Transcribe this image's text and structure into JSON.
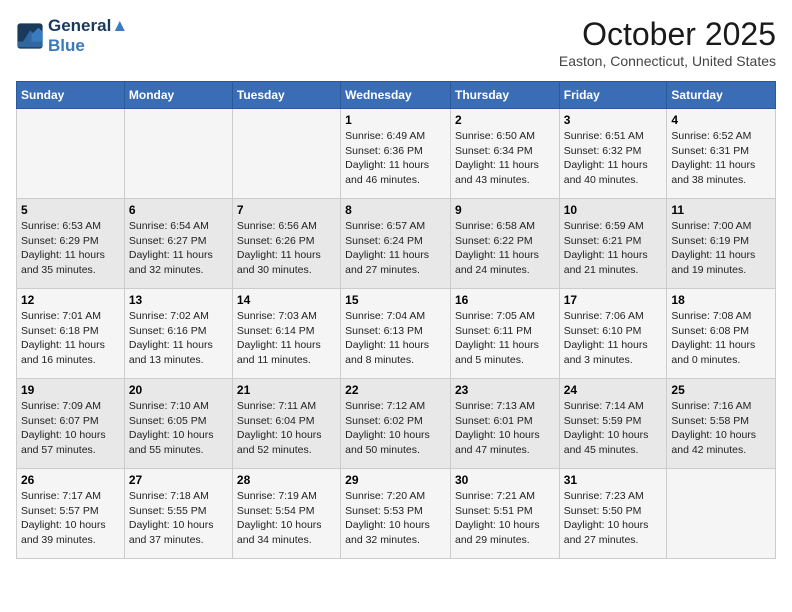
{
  "header": {
    "logo_line1": "General",
    "logo_line2": "Blue",
    "month_title": "October 2025",
    "location": "Easton, Connecticut, United States"
  },
  "days_of_week": [
    "Sunday",
    "Monday",
    "Tuesday",
    "Wednesday",
    "Thursday",
    "Friday",
    "Saturday"
  ],
  "weeks": [
    [
      {
        "day": "",
        "detail": ""
      },
      {
        "day": "",
        "detail": ""
      },
      {
        "day": "",
        "detail": ""
      },
      {
        "day": "1",
        "detail": "Sunrise: 6:49 AM\nSunset: 6:36 PM\nDaylight: 11 hours and 46 minutes."
      },
      {
        "day": "2",
        "detail": "Sunrise: 6:50 AM\nSunset: 6:34 PM\nDaylight: 11 hours and 43 minutes."
      },
      {
        "day": "3",
        "detail": "Sunrise: 6:51 AM\nSunset: 6:32 PM\nDaylight: 11 hours and 40 minutes."
      },
      {
        "day": "4",
        "detail": "Sunrise: 6:52 AM\nSunset: 6:31 PM\nDaylight: 11 hours and 38 minutes."
      }
    ],
    [
      {
        "day": "5",
        "detail": "Sunrise: 6:53 AM\nSunset: 6:29 PM\nDaylight: 11 hours and 35 minutes."
      },
      {
        "day": "6",
        "detail": "Sunrise: 6:54 AM\nSunset: 6:27 PM\nDaylight: 11 hours and 32 minutes."
      },
      {
        "day": "7",
        "detail": "Sunrise: 6:56 AM\nSunset: 6:26 PM\nDaylight: 11 hours and 30 minutes."
      },
      {
        "day": "8",
        "detail": "Sunrise: 6:57 AM\nSunset: 6:24 PM\nDaylight: 11 hours and 27 minutes."
      },
      {
        "day": "9",
        "detail": "Sunrise: 6:58 AM\nSunset: 6:22 PM\nDaylight: 11 hours and 24 minutes."
      },
      {
        "day": "10",
        "detail": "Sunrise: 6:59 AM\nSunset: 6:21 PM\nDaylight: 11 hours and 21 minutes."
      },
      {
        "day": "11",
        "detail": "Sunrise: 7:00 AM\nSunset: 6:19 PM\nDaylight: 11 hours and 19 minutes."
      }
    ],
    [
      {
        "day": "12",
        "detail": "Sunrise: 7:01 AM\nSunset: 6:18 PM\nDaylight: 11 hours and 16 minutes."
      },
      {
        "day": "13",
        "detail": "Sunrise: 7:02 AM\nSunset: 6:16 PM\nDaylight: 11 hours and 13 minutes."
      },
      {
        "day": "14",
        "detail": "Sunrise: 7:03 AM\nSunset: 6:14 PM\nDaylight: 11 hours and 11 minutes."
      },
      {
        "day": "15",
        "detail": "Sunrise: 7:04 AM\nSunset: 6:13 PM\nDaylight: 11 hours and 8 minutes."
      },
      {
        "day": "16",
        "detail": "Sunrise: 7:05 AM\nSunset: 6:11 PM\nDaylight: 11 hours and 5 minutes."
      },
      {
        "day": "17",
        "detail": "Sunrise: 7:06 AM\nSunset: 6:10 PM\nDaylight: 11 hours and 3 minutes."
      },
      {
        "day": "18",
        "detail": "Sunrise: 7:08 AM\nSunset: 6:08 PM\nDaylight: 11 hours and 0 minutes."
      }
    ],
    [
      {
        "day": "19",
        "detail": "Sunrise: 7:09 AM\nSunset: 6:07 PM\nDaylight: 10 hours and 57 minutes."
      },
      {
        "day": "20",
        "detail": "Sunrise: 7:10 AM\nSunset: 6:05 PM\nDaylight: 10 hours and 55 minutes."
      },
      {
        "day": "21",
        "detail": "Sunrise: 7:11 AM\nSunset: 6:04 PM\nDaylight: 10 hours and 52 minutes."
      },
      {
        "day": "22",
        "detail": "Sunrise: 7:12 AM\nSunset: 6:02 PM\nDaylight: 10 hours and 50 minutes."
      },
      {
        "day": "23",
        "detail": "Sunrise: 7:13 AM\nSunset: 6:01 PM\nDaylight: 10 hours and 47 minutes."
      },
      {
        "day": "24",
        "detail": "Sunrise: 7:14 AM\nSunset: 5:59 PM\nDaylight: 10 hours and 45 minutes."
      },
      {
        "day": "25",
        "detail": "Sunrise: 7:16 AM\nSunset: 5:58 PM\nDaylight: 10 hours and 42 minutes."
      }
    ],
    [
      {
        "day": "26",
        "detail": "Sunrise: 7:17 AM\nSunset: 5:57 PM\nDaylight: 10 hours and 39 minutes."
      },
      {
        "day": "27",
        "detail": "Sunrise: 7:18 AM\nSunset: 5:55 PM\nDaylight: 10 hours and 37 minutes."
      },
      {
        "day": "28",
        "detail": "Sunrise: 7:19 AM\nSunset: 5:54 PM\nDaylight: 10 hours and 34 minutes."
      },
      {
        "day": "29",
        "detail": "Sunrise: 7:20 AM\nSunset: 5:53 PM\nDaylight: 10 hours and 32 minutes."
      },
      {
        "day": "30",
        "detail": "Sunrise: 7:21 AM\nSunset: 5:51 PM\nDaylight: 10 hours and 29 minutes."
      },
      {
        "day": "31",
        "detail": "Sunrise: 7:23 AM\nSunset: 5:50 PM\nDaylight: 10 hours and 27 minutes."
      },
      {
        "day": "",
        "detail": ""
      }
    ]
  ]
}
